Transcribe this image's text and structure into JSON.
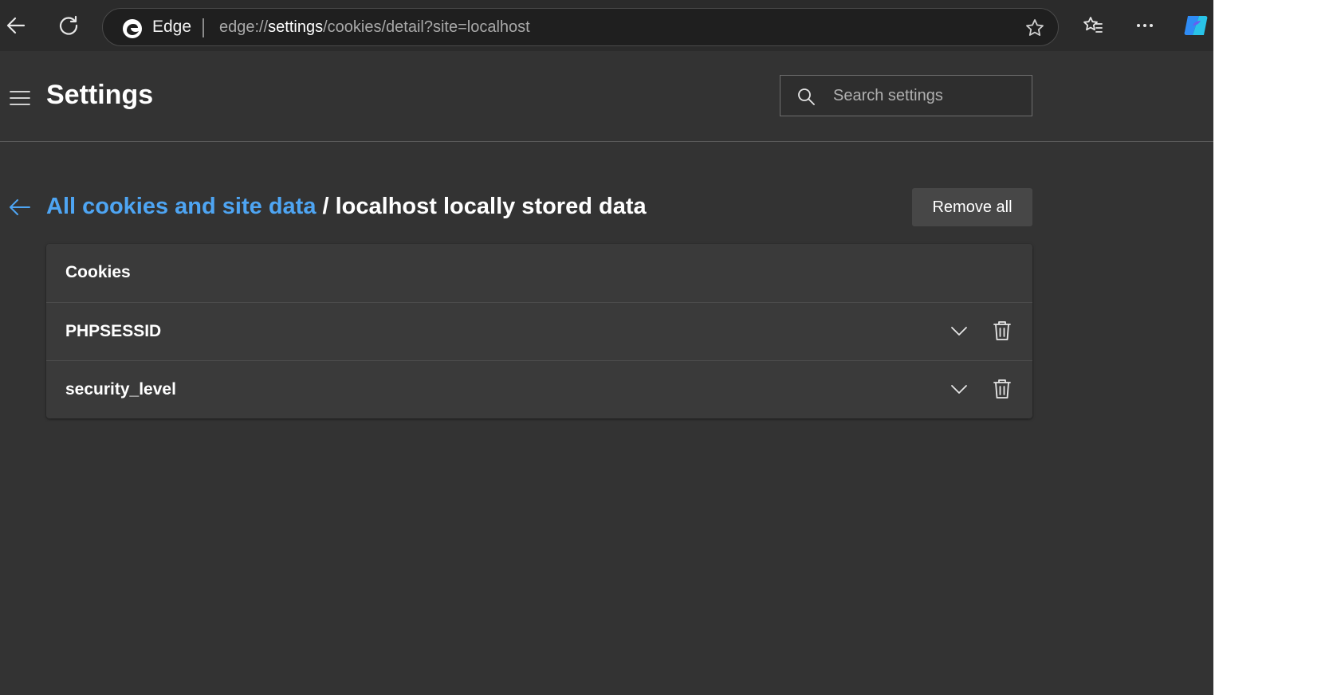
{
  "browser": {
    "product_name": "Edge",
    "url_scheme": "edge://",
    "url_host": "settings",
    "url_path": "/cookies/detail?site=localhost",
    "accent": "#4ea5f3"
  },
  "settings": {
    "title": "Settings",
    "search_placeholder": "Search settings"
  },
  "breadcrumb": {
    "parent_label": "All cookies and site data",
    "separator": " / ",
    "current_label": "localhost locally stored data"
  },
  "actions": {
    "remove_all_label": "Remove all"
  },
  "cookies": {
    "header": "Cookies",
    "items": [
      {
        "name": "PHPSESSID"
      },
      {
        "name": "security_level"
      }
    ]
  },
  "icons": [
    "back-arrow-icon",
    "refresh-icon",
    "edge-logo-icon",
    "favorite-star-icon",
    "favorites-icon",
    "more-icon",
    "copilot-icon",
    "hamburger-menu-icon",
    "search-icon",
    "chevron-down-icon",
    "trash-icon"
  ]
}
